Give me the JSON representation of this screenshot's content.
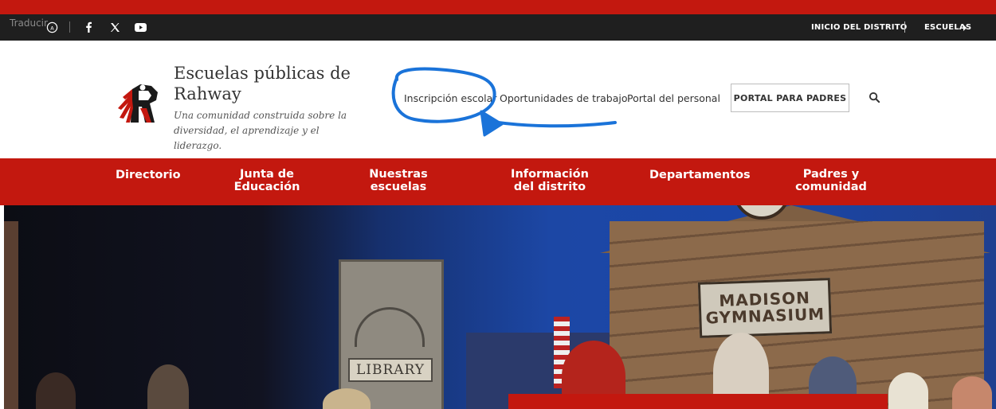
{
  "utility_bar": {
    "translate_label": "Traducir",
    "right_links": [
      "INICIO DEL DISTRITO",
      "ESCUELAS"
    ]
  },
  "header": {
    "title": "Escuelas públicas de Rahway",
    "tagline": "Una comunidad construida sobre la diversidad, el aprendizaje y el liderazgo.",
    "links": [
      "Inscripción escolar",
      "Oportunidades de trabajo",
      "Portal del personal"
    ],
    "portal_button": "PORTAL PARA PADRES"
  },
  "main_nav": {
    "items": [
      "Directorio",
      "Junta de Educación",
      "Nuestras escuelas",
      "Información del distrito",
      "Departamentos",
      "Padres y comunidad"
    ]
  },
  "hero": {
    "library_sign": "LIBRARY",
    "building_sign_line1": "MADISON",
    "building_sign_line2": "GYMNASIUM"
  },
  "colors": {
    "brand_red": "#c3180f",
    "utility_bar": "#1f1f1f",
    "annotation_blue": "#1a73d9"
  }
}
